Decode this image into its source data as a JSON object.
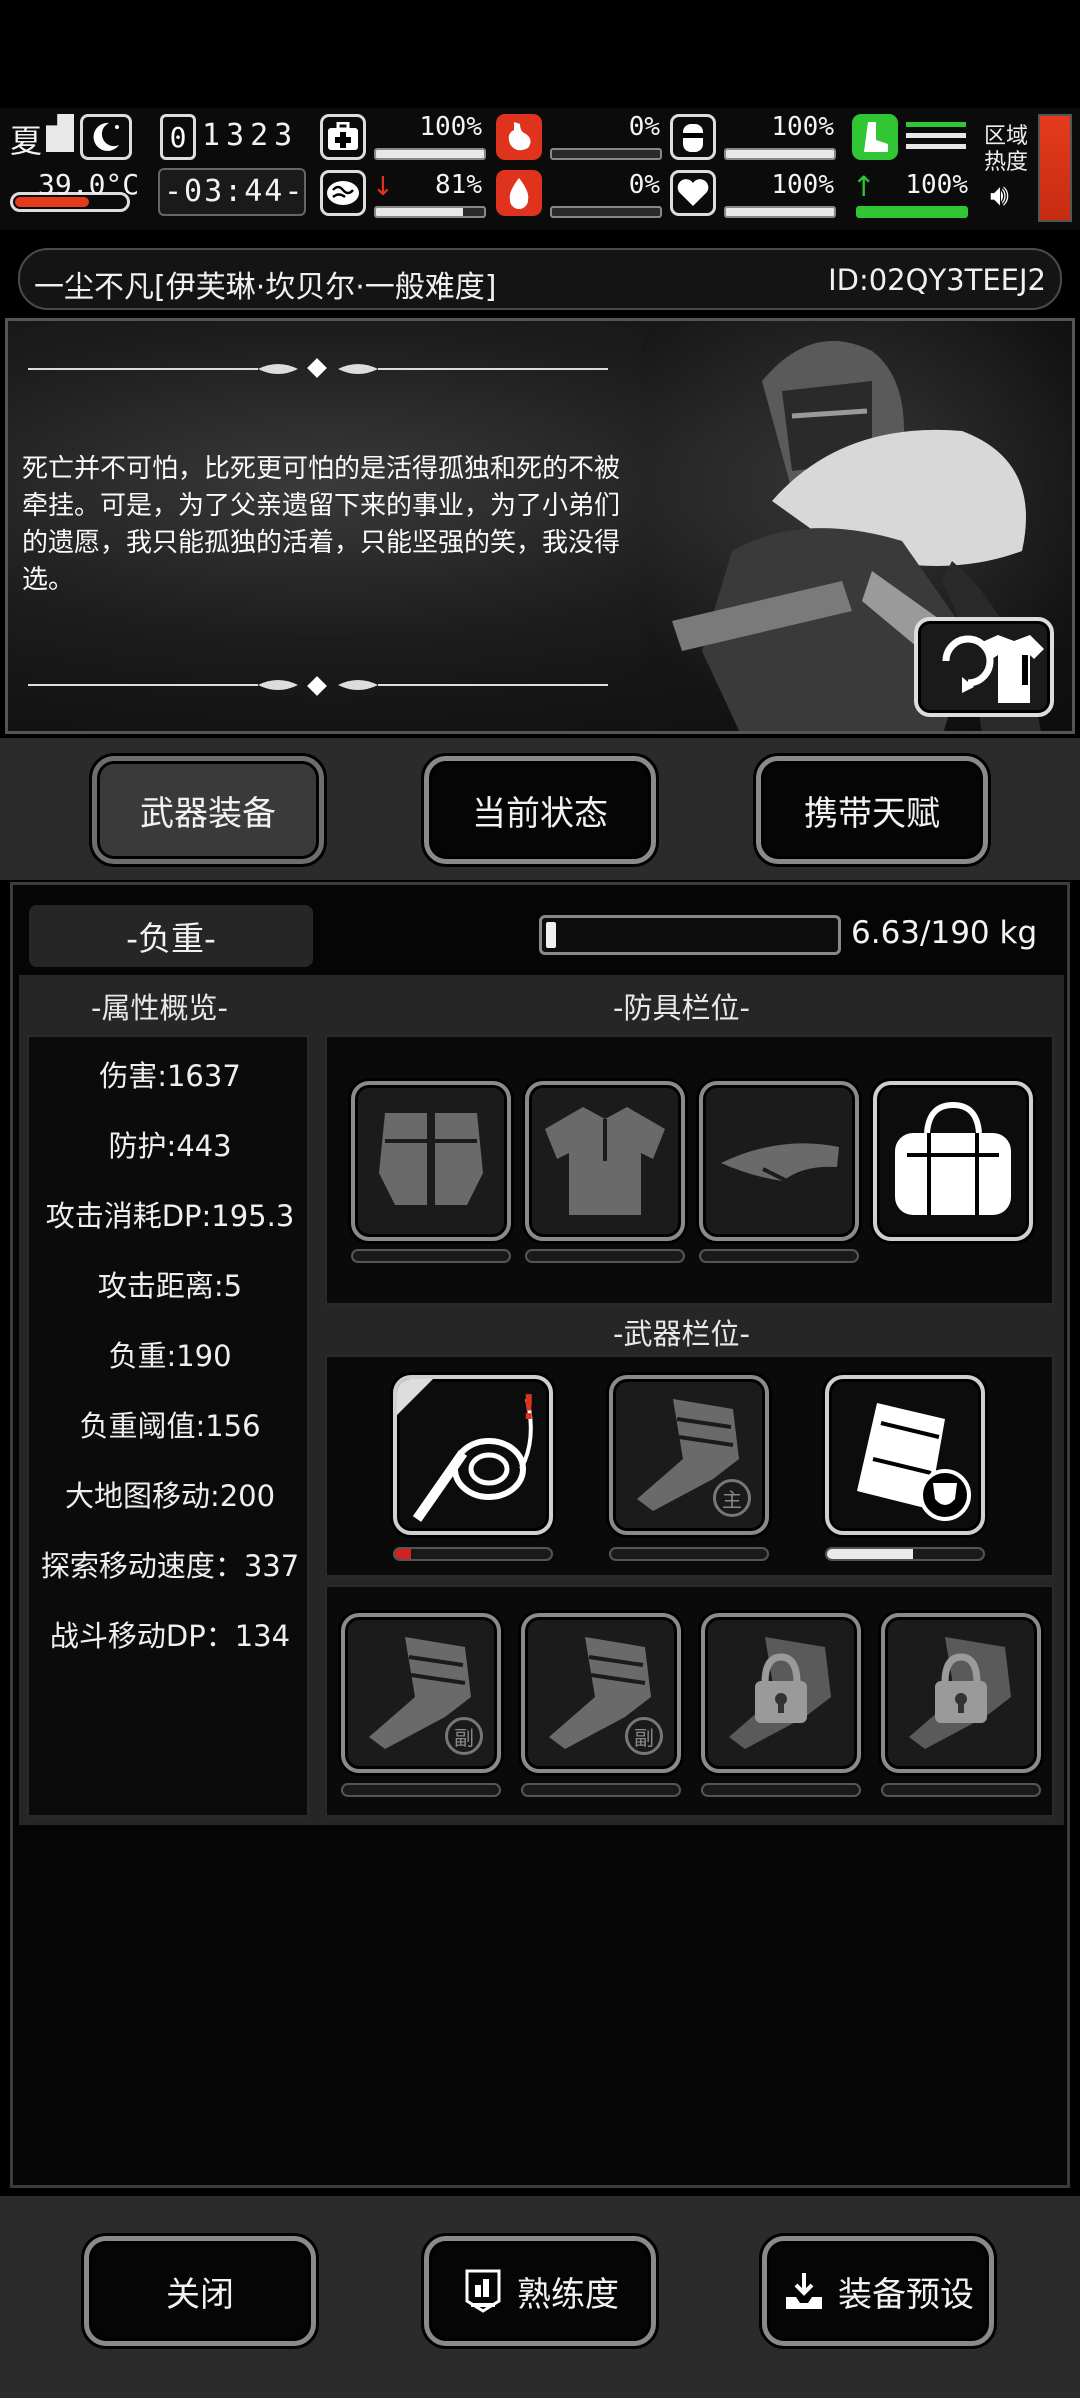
{
  "status": {
    "season": "夏",
    "temperature": "39.0°C",
    "day_counter": "1323",
    "clock": "-03:44-",
    "health_pct": "100%",
    "health_level": 1.0,
    "stomach_pct": "0%",
    "stomach_level": 0.0,
    "water_pct": "100%",
    "water_level": 1.0,
    "sanity_pct": "81%",
    "sanity_level": 0.81,
    "blood_pct": "0%",
    "blood_level": 0.0,
    "heart_pct": "100%",
    "heart_level": 1.0,
    "stamina_pct": "100%",
    "stamina_level": 1.0,
    "zone_heat_label": "区域\n热度",
    "colors": {
      "stomach": "#e0331e",
      "blood": "#e0331e",
      "stamina": "#31c634",
      "heat": "#e53a1c"
    }
  },
  "header": {
    "title": "一尘不凡[伊芙琳·坎贝尔·一般难度]",
    "id": "ID:02QY3TEEJ2"
  },
  "story": {
    "quote": "死亡并不可怕，比死更可怕的是活得孤独和死的不被牵挂。可是，为了父亲遗留下来的事业，为了小弟们的遗愿，我只能孤独的活着，只能坚强的笑，我没得选。"
  },
  "tabs": [
    {
      "label": "武器装备",
      "active": true
    },
    {
      "label": "当前状态",
      "active": false
    },
    {
      "label": "携带天赋",
      "active": false
    }
  ],
  "weight": {
    "label": "-负重-",
    "value_text": "6.63/190 kg",
    "fraction": 0.035
  },
  "sections": {
    "attributes": "-属性概览-",
    "armor": "-防具栏位-",
    "weapons": "-武器栏位-"
  },
  "attributes": [
    "伤害:1637",
    "防护:443",
    "攻击消耗DP:195.3",
    "攻击距离:5",
    "负重:190",
    "负重阈值:156",
    "大地图移动:200",
    "探索移动速度：337",
    "战斗移动DP：134"
  ],
  "armor_slots": [
    {
      "icon": "gloves-icon",
      "durability": 0
    },
    {
      "icon": "shirt-icon",
      "durability": 0
    },
    {
      "icon": "visor-cap-icon",
      "durability": 0
    },
    {
      "icon": "duffel-bag-icon",
      "durability": 0
    }
  ],
  "weapon_slots": [
    {
      "icon": "whip-icon",
      "durability": 0.1,
      "bar_color": "#d42020"
    },
    {
      "icon": "fist-icon",
      "badge": "主",
      "durability": 0
    },
    {
      "icon": "backpack-shield-icon",
      "durability": 0.55,
      "bar_color": "#eaeaea"
    }
  ],
  "secondary_slots": [
    {
      "icon": "fist-icon",
      "badge": "副"
    },
    {
      "icon": "fist-icon",
      "badge": "副"
    },
    {
      "icon": "fist-locked-icon"
    },
    {
      "icon": "fist-locked-icon"
    }
  ],
  "bottom": {
    "close": "关闭",
    "proficiency": "熟练度",
    "preset": "装备预设"
  }
}
